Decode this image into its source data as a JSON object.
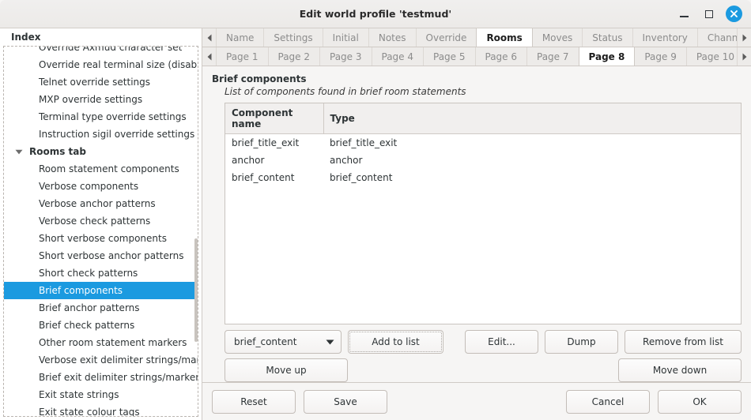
{
  "window": {
    "title": "Edit world profile 'testmud'",
    "controls": {
      "minimize": "minimize",
      "maximize": "maximize",
      "close": "close"
    }
  },
  "sidebar": {
    "header": "Index",
    "items": [
      {
        "label": "Override Axmud character set",
        "type": "leaf",
        "selected": false,
        "clipped": true
      },
      {
        "label": "Override real terminal size (disables",
        "type": "leaf",
        "selected": false
      },
      {
        "label": "Telnet override settings",
        "type": "leaf",
        "selected": false
      },
      {
        "label": "MXP override settings",
        "type": "leaf",
        "selected": false
      },
      {
        "label": "Terminal type override settings",
        "type": "leaf",
        "selected": false
      },
      {
        "label": "Instruction sigil override settings",
        "type": "leaf",
        "selected": false
      },
      {
        "label": "Rooms tab",
        "type": "group",
        "expanded": true,
        "selected": false
      },
      {
        "label": "Room statement components",
        "type": "leaf",
        "selected": false
      },
      {
        "label": "Verbose components",
        "type": "leaf",
        "selected": false
      },
      {
        "label": "Verbose anchor patterns",
        "type": "leaf",
        "selected": false
      },
      {
        "label": "Verbose check patterns",
        "type": "leaf",
        "selected": false
      },
      {
        "label": "Short verbose components",
        "type": "leaf",
        "selected": false
      },
      {
        "label": "Short verbose anchor patterns",
        "type": "leaf",
        "selected": false
      },
      {
        "label": "Short check patterns",
        "type": "leaf",
        "selected": false
      },
      {
        "label": "Brief components",
        "type": "leaf",
        "selected": true
      },
      {
        "label": "Brief anchor patterns",
        "type": "leaf",
        "selected": false
      },
      {
        "label": "Brief check patterns",
        "type": "leaf",
        "selected": false
      },
      {
        "label": "Other room statement markers",
        "type": "leaf",
        "selected": false
      },
      {
        "label": "Verbose exit delimiter strings/mark",
        "type": "leaf",
        "selected": false
      },
      {
        "label": "Brief exit delimiter strings/marker p",
        "type": "leaf",
        "selected": false
      },
      {
        "label": "Exit state strings",
        "type": "leaf",
        "selected": false
      },
      {
        "label": "Exit state colour tags",
        "type": "leaf",
        "selected": false,
        "clipped": true
      }
    ],
    "selection_color": "#1b9ae0"
  },
  "main_tabs": {
    "prev_arrow": "scroll-left",
    "next_arrow": "scroll-right",
    "items": [
      {
        "label": "Name",
        "active": false
      },
      {
        "label": "Settings",
        "active": false
      },
      {
        "label": "Initial",
        "active": false
      },
      {
        "label": "Notes",
        "active": false
      },
      {
        "label": "Override",
        "active": false
      },
      {
        "label": "Rooms",
        "active": true
      },
      {
        "label": "Moves",
        "active": false
      },
      {
        "label": "Status",
        "active": false
      },
      {
        "label": "Inventory",
        "active": false
      },
      {
        "label": "Channels",
        "active": false
      }
    ]
  },
  "page_tabs": {
    "prev_arrow": "scroll-left",
    "next_arrow": "scroll-right",
    "items": [
      {
        "label": "Page 1",
        "active": false
      },
      {
        "label": "Page 2",
        "active": false
      },
      {
        "label": "Page 3",
        "active": false
      },
      {
        "label": "Page 4",
        "active": false
      },
      {
        "label": "Page 5",
        "active": false
      },
      {
        "label": "Page 6",
        "active": false
      },
      {
        "label": "Page 7",
        "active": false
      },
      {
        "label": "Page 8",
        "active": true
      },
      {
        "label": "Page 9",
        "active": false
      },
      {
        "label": "Page 10",
        "active": false
      }
    ]
  },
  "page": {
    "title": "Brief components",
    "subtitle": "List of components found in brief room statements",
    "table": {
      "columns": [
        "Component name",
        "Type"
      ],
      "rows": [
        [
          "brief_title_exit",
          "brief_title_exit"
        ],
        [
          "anchor",
          "anchor"
        ],
        [
          "brief_content",
          "brief_content"
        ]
      ]
    },
    "controls": {
      "component_combo_value": "brief_content",
      "add_to_list": "Add to list",
      "edit": "Edit...",
      "dump": "Dump",
      "remove_from_list": "Remove from list",
      "move_up": "Move up",
      "move_down": "Move down"
    }
  },
  "bottom_bar": {
    "reset": "Reset",
    "save": "Save",
    "cancel": "Cancel",
    "ok": "OK"
  }
}
